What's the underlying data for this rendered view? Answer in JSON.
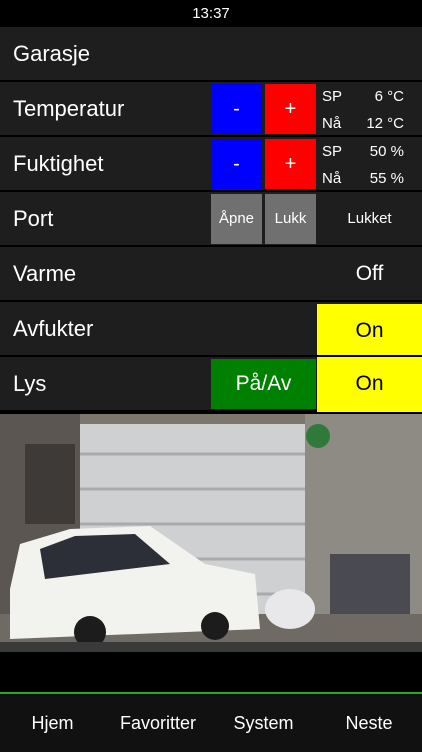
{
  "status_bar": {
    "time": "13:37"
  },
  "header": {
    "title": "Garasje"
  },
  "rows": {
    "temperatur": {
      "label": "Temperatur",
      "minus": "-",
      "plus": "+",
      "sp_label": "SP",
      "sp_value": "6 °C",
      "na_label": "Nå",
      "na_value": "12 °C"
    },
    "fuktighet": {
      "label": "Fuktighet",
      "minus": "-",
      "plus": "+",
      "sp_label": "SP",
      "sp_value": "50 %",
      "na_label": "Nå",
      "na_value": "55 %"
    },
    "port": {
      "label": "Port",
      "open": "Åpne",
      "close": "Lukk",
      "state": "Lukket"
    },
    "varme": {
      "label": "Varme",
      "state": "Off"
    },
    "avfukter": {
      "label": "Avfukter",
      "state": "On"
    },
    "lys": {
      "label": "Lys",
      "toggle": "På/Av",
      "state": "On"
    }
  },
  "camera": {
    "icon": "camera-feed"
  },
  "tabs": [
    "Hjem",
    "Favoritter",
    "System",
    "Neste"
  ],
  "colors": {
    "minus": "#0000ff",
    "plus": "#ff0000",
    "on": "#ffff00",
    "toggle": "#008000",
    "tab_accent": "#2aa52a"
  }
}
